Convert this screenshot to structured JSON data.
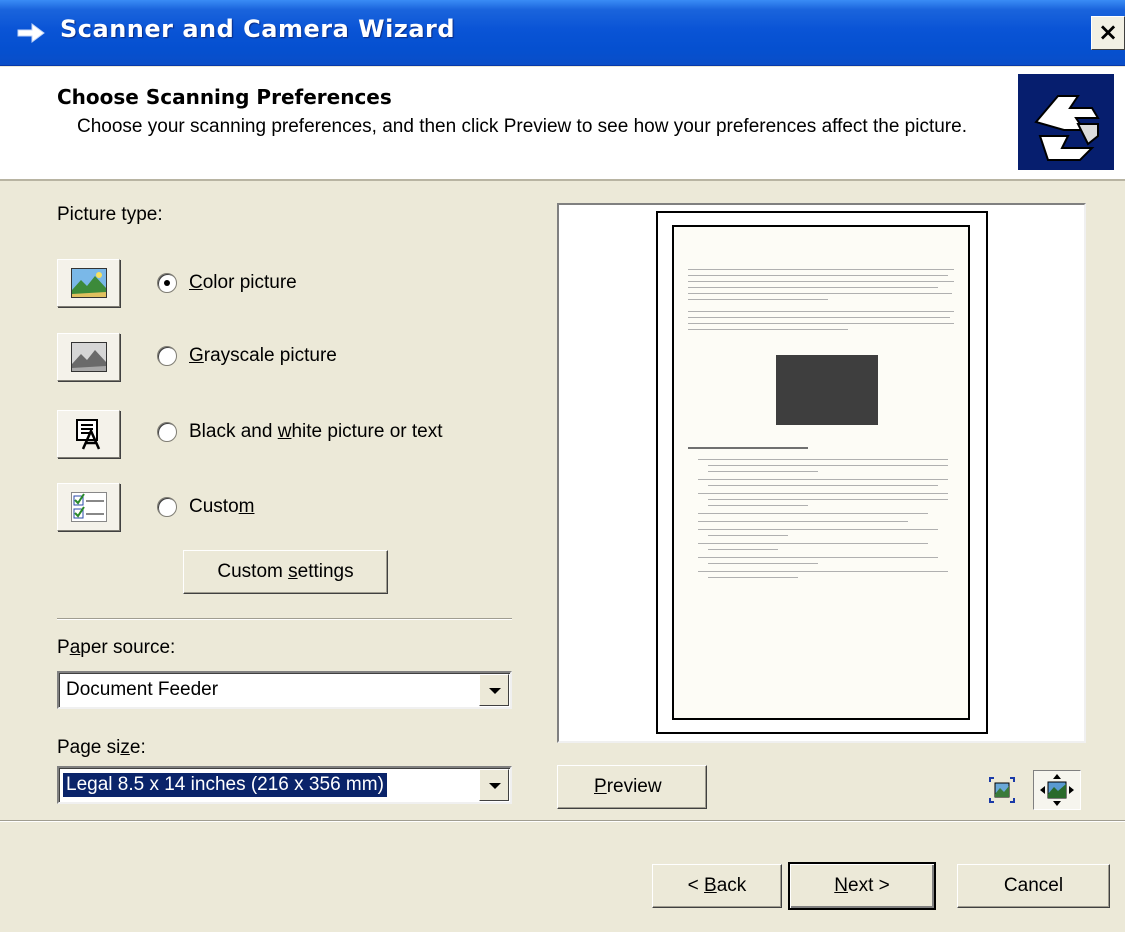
{
  "window": {
    "title": "Scanner and Camera Wizard"
  },
  "header": {
    "title": "Choose Scanning Preferences",
    "description": "Choose your scanning preferences, and then click Preview to see how your preferences affect the picture."
  },
  "picture_type": {
    "label": "Picture type:",
    "options": [
      {
        "pre": "",
        "key": "C",
        "post": "olor picture",
        "checked": true,
        "icon": "color-picture-icon"
      },
      {
        "pre": "",
        "key": "G",
        "post": "rayscale picture",
        "checked": false,
        "icon": "grayscale-picture-icon"
      },
      {
        "pre": "Black and ",
        "key": "w",
        "post": "hite picture or text",
        "checked": false,
        "icon": "black-white-text-icon"
      },
      {
        "pre": "Custo",
        "key": "m",
        "post": "",
        "checked": false,
        "icon": "custom-checklist-icon"
      }
    ],
    "custom_settings": {
      "pre": "Custom ",
      "key": "s",
      "post": "ettings"
    }
  },
  "paper_source": {
    "pre": "P",
    "key": "a",
    "post": "per source:",
    "value": "Document Feeder"
  },
  "page_size": {
    "pre": "Page si",
    "key": "z",
    "post": "e:",
    "value": "Legal 8.5 x 14 inches (216 x 356 mm)"
  },
  "preview": {
    "key": "P",
    "post": "review"
  },
  "footer": {
    "back": {
      "pre": "< ",
      "key": "B",
      "post": "ack"
    },
    "next": {
      "pre": "",
      "key": "N",
      "post": "ext >"
    },
    "cancel": "Cancel"
  },
  "colors": {
    "titlebar": "#0a54d6",
    "dialog": "#ece9d8",
    "selection": "#0a246a"
  }
}
